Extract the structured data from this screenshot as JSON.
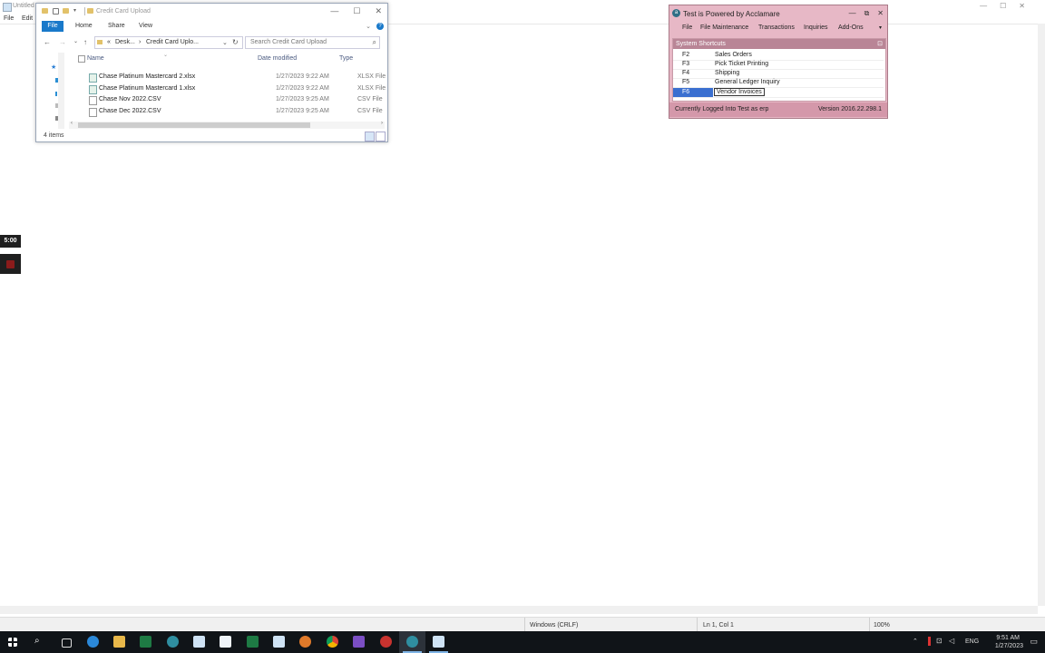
{
  "notepad": {
    "title": "Untitled",
    "menu": [
      "File",
      "Edit"
    ],
    "status": {
      "line_ending": "Windows (CRLF)",
      "position": "Ln 1, Col 1",
      "zoom": "100%"
    }
  },
  "explorer": {
    "title": "Credit Card Upload",
    "ribbon": {
      "file": "File",
      "tabs": [
        "Home",
        "Share",
        "View"
      ]
    },
    "address": {
      "prefix": "«",
      "crumb1": "Desk...",
      "sep": "›",
      "crumb2": "Credit Card Uplo..."
    },
    "search_placeholder": "Search Credit Card Upload",
    "columns": {
      "name": "Name",
      "date": "Date modified",
      "type": "Type"
    },
    "files": [
      {
        "name": "Chase Platinum Mastercard 2.xlsx",
        "date": "1/27/2023 9:22 AM",
        "type": "XLSX File",
        "icon": "xlsx-file-icon"
      },
      {
        "name": "Chase Platinum Mastercard 1.xlsx",
        "date": "1/27/2023 9:22 AM",
        "type": "XLSX File",
        "icon": "xlsx-file-icon"
      },
      {
        "name": "Chase Nov 2022.CSV",
        "date": "1/27/2023 9:25 AM",
        "type": "CSV File",
        "icon": "csv-file-icon"
      },
      {
        "name": "Chase Dec 2022.CSV",
        "date": "1/27/2023 9:25 AM",
        "type": "CSV File",
        "icon": "csv-file-icon"
      }
    ],
    "item_count": "4 items"
  },
  "timer": {
    "value": "5:00"
  },
  "acclamare": {
    "title": "Test is Powered by Acclamare",
    "menu": [
      "File",
      "File Maintenance",
      "Transactions",
      "Inquiries",
      "Add-Ons"
    ],
    "shortcuts_header": "System Shortcuts",
    "shortcuts": [
      {
        "key": "F2",
        "label": "Sales Orders"
      },
      {
        "key": "F3",
        "label": "Pick Ticket Printing"
      },
      {
        "key": "F4",
        "label": "Shipping"
      },
      {
        "key": "F5",
        "label": "General Ledger Inquiry"
      },
      {
        "key": "F6",
        "label": "Vendor Invoices"
      }
    ],
    "status_left": "Currently Logged Into Test as erp",
    "status_right": "Version 2016.22.298.1",
    "colors": {
      "window": "#e7b8c6",
      "selected": "#3a6fd0"
    }
  },
  "taskbar": {
    "apps": [
      "start-icon",
      "search-icon",
      "task-view-icon",
      "edge-icon",
      "file-explorer-icon",
      "excel-icon",
      "acclamare-icon",
      "notepad-icon",
      "notepad-icon",
      "excel-icon",
      "notepad-icon",
      "acclamare-orange-icon",
      "chrome-icon",
      "visual-studio-icon",
      "acclamare-red-icon",
      "acclamare-active-icon",
      "notepad-active-icon"
    ],
    "lang": "ENG",
    "time": "9:51 AM",
    "date": "1/27/2023"
  }
}
